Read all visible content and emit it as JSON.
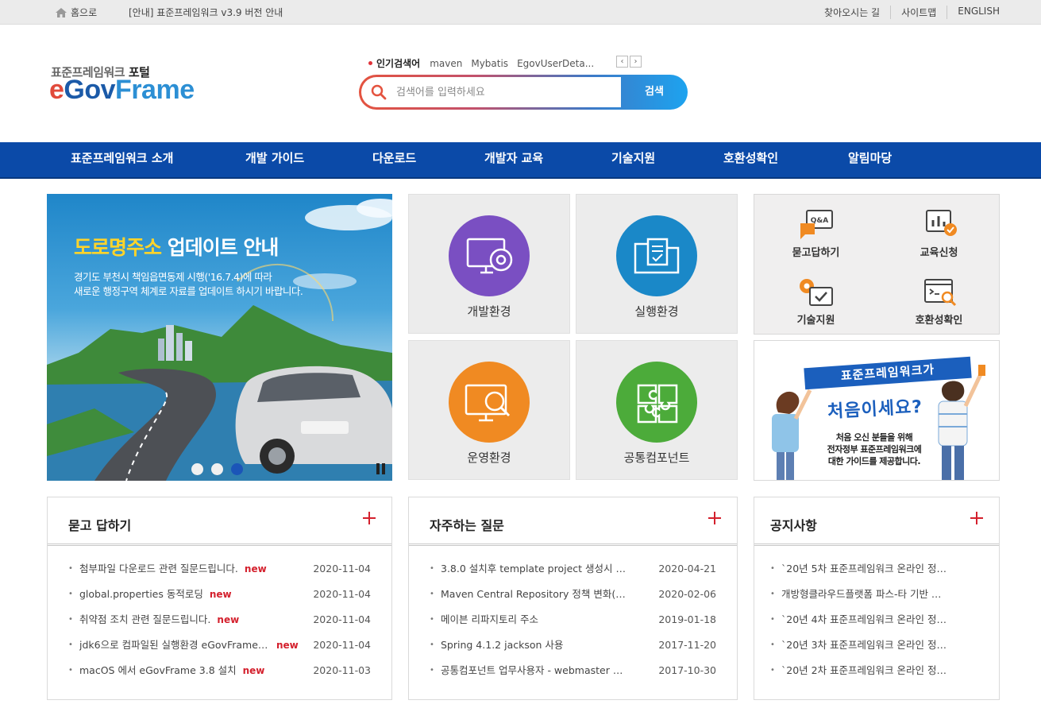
{
  "topbar": {
    "home_label": "홈으로",
    "notice": "[안내] 표준프레임워크 v3.9 버전 안내",
    "links": [
      "찾아오시는 길",
      "사이트맵",
      "ENGLISH"
    ]
  },
  "header": {
    "logo_sub_prefix": "표준프레임워크 ",
    "logo_sub_bold": "포털",
    "logo_main_e": "e",
    "logo_main_gov": "Gov",
    "logo_main_frame": "Frame"
  },
  "search": {
    "popular_label": "인기검색어",
    "keywords": [
      "maven",
      "Mybatis",
      "EgovUserDeta..."
    ],
    "placeholder": "검색어를 입력하세요",
    "button": "검색",
    "prev": "‹",
    "next": "›"
  },
  "nav": [
    "표준프레임워크 소개",
    "개발 가이드",
    "다운로드",
    "개발자 교육",
    "기술지원",
    "호환성확인",
    "알림마당"
  ],
  "banner": {
    "title_hl": "도로명주소",
    "title_rest": " 업데이트 안내",
    "desc1": "경기도 부천시 책임읍면동제 시행('16.7.4)에 따라",
    "desc2": "새로운 행정구역 체계로 자료를 업데이트 하시기 바랍니다.",
    "active_slide": 3,
    "slide_count": 3
  },
  "tiles": [
    {
      "label": "개발환경",
      "color": "#7a4fc2",
      "icon": "monitor-gear-icon"
    },
    {
      "label": "실행환경",
      "color": "#1a88c8",
      "icon": "folder-document-icon"
    },
    {
      "label": "운영환경",
      "color": "#f08a22",
      "icon": "monitor-search-icon"
    },
    {
      "label": "공통컴포넌트",
      "color": "#4cab3a",
      "icon": "puzzle-icon"
    }
  ],
  "quick": [
    {
      "label": "묻고답하기",
      "icon": "qna-icon"
    },
    {
      "label": "교육신청",
      "icon": "chart-check-icon"
    },
    {
      "label": "기술지원",
      "icon": "gear-check-icon"
    },
    {
      "label": "호환성확인",
      "icon": "code-search-icon"
    }
  ],
  "promo": {
    "ribbon": "표준프레임워크가",
    "big": "처음이세요?",
    "line1": "처음 오신 분들을 위해",
    "line2": "전자정부 표준프레임워크에",
    "line3": "대한 가이드를 제공합니다."
  },
  "boards": [
    {
      "title": "묻고 답하기",
      "items": [
        {
          "text": "첨부파일 다운로드 관련 질문드립니다.",
          "new": "new",
          "date": "2020-11-04"
        },
        {
          "text": "global.properties 동적로딩",
          "new": "new",
          "date": "2020-11-04"
        },
        {
          "text": "취약점 조치 관련 질문드립니다.",
          "new": "new",
          "date": "2020-11-04"
        },
        {
          "text": "jdk6으로 컴파일된 실행환경 eGovFrame …",
          "new": "new",
          "date": "2020-11-04"
        },
        {
          "text": "macOS 에서 eGovFrame 3.8 설치",
          "new": "new",
          "date": "2020-11-03"
        }
      ]
    },
    {
      "title": "자주하는 질문",
      "items": [
        {
          "text": "3.8.0 설치후 template project 생성시 …",
          "new": "",
          "date": "2020-04-21"
        },
        {
          "text": "Maven Central Repository 정책 변화(2…",
          "new": "",
          "date": "2020-02-06"
        },
        {
          "text": "메이븐 리파지토리 주소",
          "new": "",
          "date": "2019-01-18"
        },
        {
          "text": "Spring 4.1.2  jackson 사용",
          "new": "",
          "date": "2017-11-20"
        },
        {
          "text": "공통컴포넌트 업무사용자 - webmaster …",
          "new": "",
          "date": "2017-10-30"
        }
      ]
    },
    {
      "title": "공지사항",
      "items": [
        {
          "text": "`20년 5차 표준프레임워크 온라인 정…",
          "new": "",
          "date": ""
        },
        {
          "text": "개방형클라우드플랫폼 파스-타 기반 …",
          "new": "",
          "date": ""
        },
        {
          "text": "`20년 4차 표준프레임워크 온라인 정…",
          "new": "",
          "date": ""
        },
        {
          "text": "`20년 3차 표준프레임워크 온라인 정…",
          "new": "",
          "date": ""
        },
        {
          "text": "`20년 2차 표준프레임워크 온라인 정…",
          "new": "",
          "date": ""
        }
      ]
    }
  ]
}
